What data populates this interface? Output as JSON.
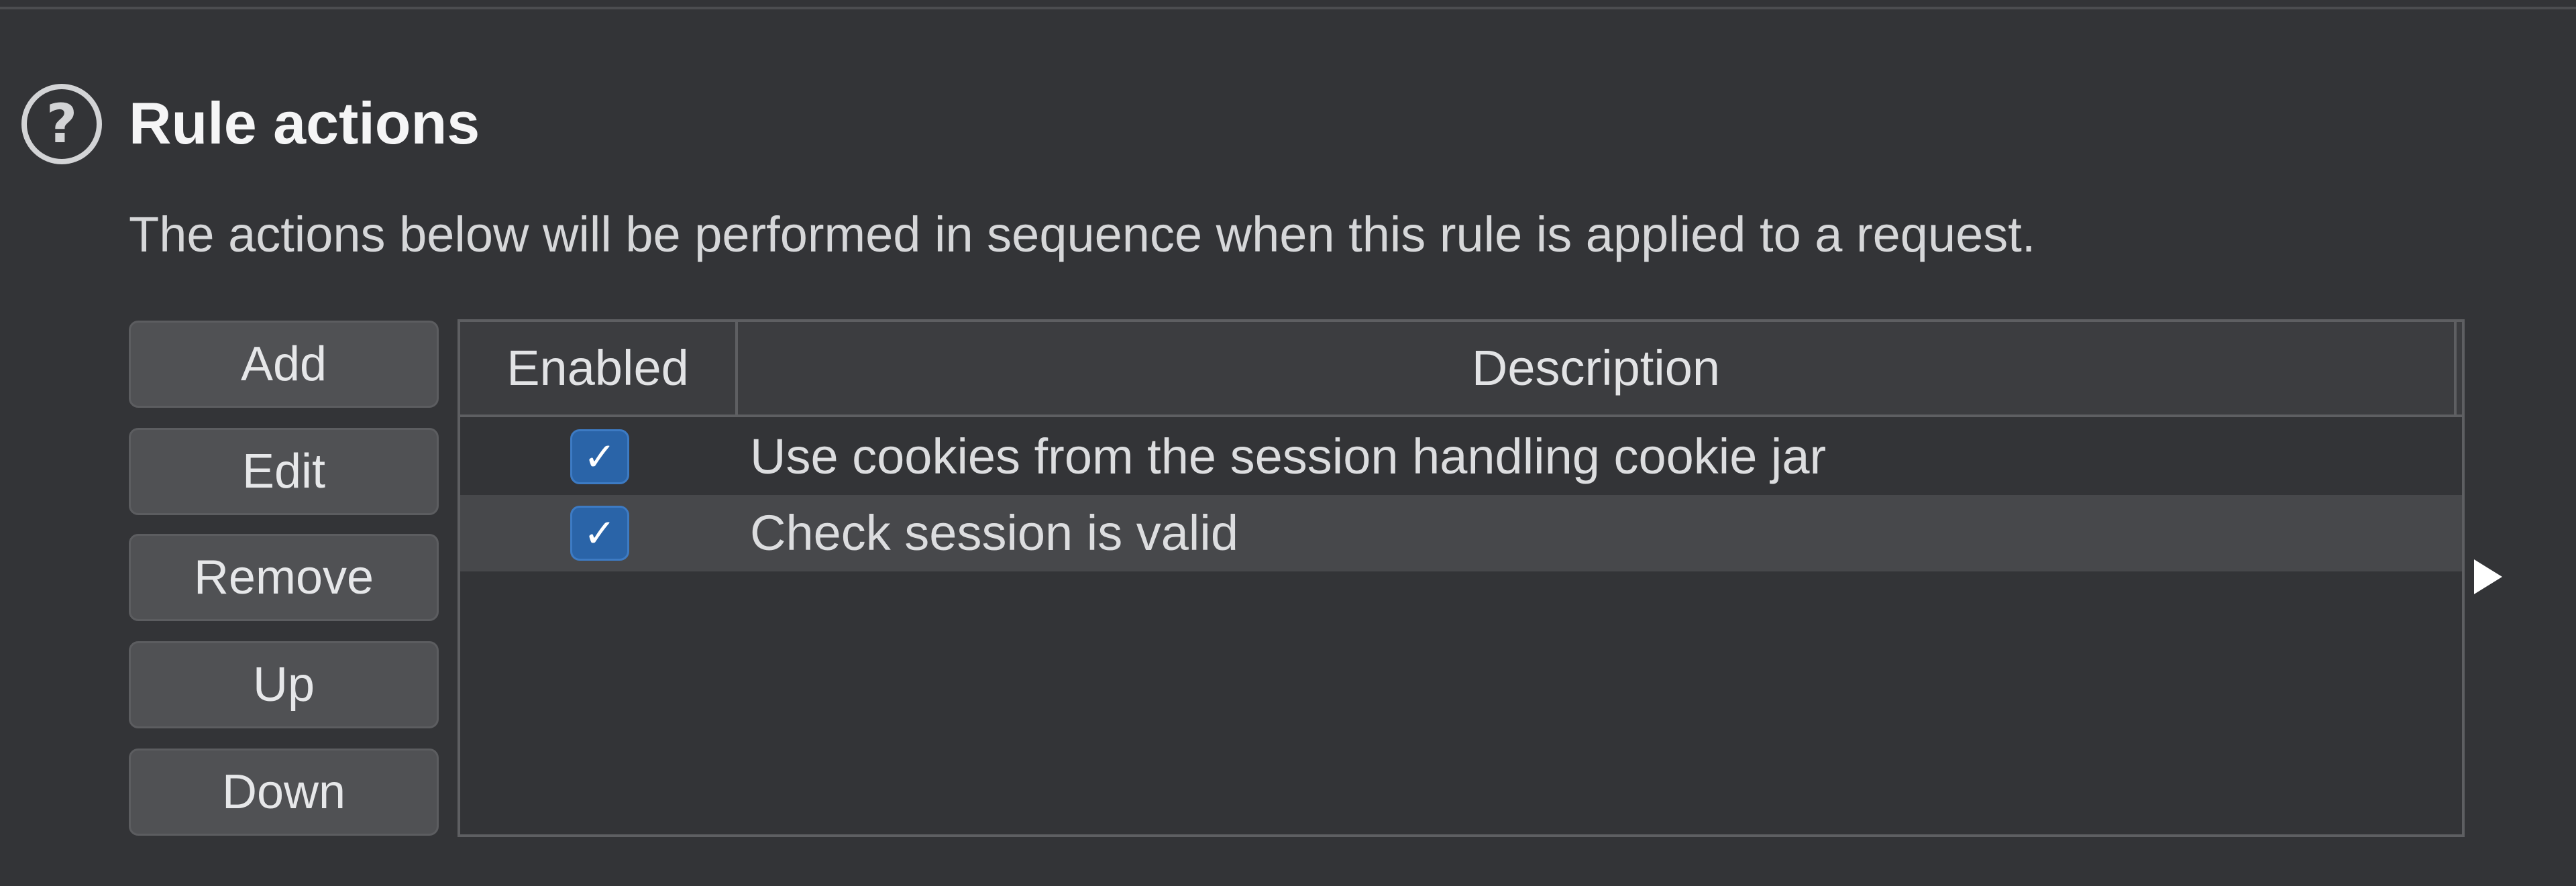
{
  "section": {
    "help_icon": "question-circle-icon",
    "help_glyph": "?",
    "title": "Rule actions",
    "description": "The actions below will be performed in sequence when this rule is applied to a request."
  },
  "buttons": {
    "add": "Add",
    "edit": "Edit",
    "remove": "Remove",
    "up": "Up",
    "down": "Down"
  },
  "table": {
    "columns": [
      "Enabled",
      "Description"
    ],
    "rows": [
      {
        "enabled": true,
        "check_glyph": "✓",
        "description": "Use cookies from the session handling cookie jar"
      },
      {
        "enabled": true,
        "check_glyph": "✓",
        "description": "Check session is valid"
      }
    ]
  },
  "colors": {
    "background": "#333437",
    "checkbox_accent": "#2a64a8",
    "selected_row": "#47484b"
  },
  "icons": {
    "expand": "triangle-right-icon"
  }
}
